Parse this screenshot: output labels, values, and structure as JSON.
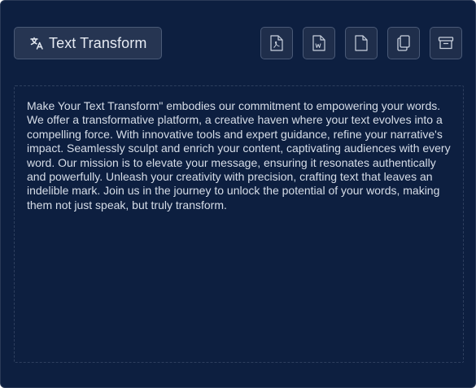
{
  "header": {
    "title_button_label": "Text Transform",
    "title_icon": "translate-icon"
  },
  "toolbar": {
    "buttons": [
      {
        "name": "export-pdf-button",
        "icon": "pdf-file-icon"
      },
      {
        "name": "export-word-button",
        "icon": "word-file-icon"
      },
      {
        "name": "new-document-button",
        "icon": "blank-file-icon"
      },
      {
        "name": "copy-button",
        "icon": "copy-icon"
      },
      {
        "name": "archive-button",
        "icon": "archive-box-icon"
      }
    ]
  },
  "editor": {
    "text": "Make Your Text Transform\" embodies our commitment to empowering your words. We offer a transformative platform, a creative haven where your text evolves into a compelling force. With innovative tools and expert guidance, refine your narrative's impact. Seamlessly sculpt and enrich your content, captivating audiences with every word. Our mission is to elevate your message, ensuring it resonates authentically and powerfully. Unleash your creativity with precision, crafting text that leaves an indelible mark. Join us in the journey to unlock the potential of your words, making them not just speak, but truly transform."
  },
  "colors": {
    "card_background": "#0d1f40",
    "button_border": "#4a5a77",
    "icon_color": "#c9d1de",
    "text_color": "#d6dde8"
  }
}
